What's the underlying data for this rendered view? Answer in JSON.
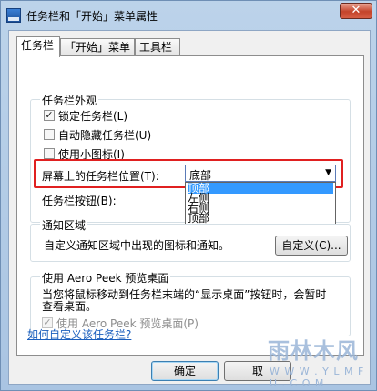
{
  "window": {
    "title": "任务栏和「开始」菜单属性",
    "close_glyph": "✕"
  },
  "tabs": [
    {
      "label": "任务栏"
    },
    {
      "label": "「开始」菜单"
    },
    {
      "label": "工具栏"
    }
  ],
  "appearance": {
    "group_title": "任务栏外观",
    "lock_taskbar": {
      "label": "锁定任务栏(L)",
      "checked": true
    },
    "auto_hide": {
      "label": "自动隐藏任务栏(U)",
      "checked": false
    },
    "small_icons": {
      "label": "使用小图标(I)",
      "checked": false
    },
    "location_label": "屏幕上的任务栏位置(T):",
    "location_value": "底部",
    "location_options": [
      "顶部",
      "左侧",
      "右侧",
      "顶部"
    ],
    "buttons_label": "任务栏按钮(B):"
  },
  "notification": {
    "group_title": "通知区域",
    "description": "自定义通知区域中出现的图标和通知。",
    "customize_button": "自定义(C)..."
  },
  "aero_peek": {
    "group_title": "使用 Aero Peek 预览桌面",
    "description_line1": "当您将鼠标移动到任务栏末端的“显示桌面”按钮时，会暂时",
    "description_line2": "查看桌面。",
    "use_peek": {
      "label": "使用 Aero Peek 预览桌面(P)",
      "checked": true
    }
  },
  "help_link": "如何自定义该任务栏?",
  "footer": {
    "ok": "确定",
    "cancel": "取"
  },
  "watermark": {
    "line1": "雨林木风",
    "line2": "W W W . Y L M F U . C O M"
  },
  "colors": {
    "highlight": "#e02020",
    "selection": "#3399ff",
    "link": "#1a5ebd"
  }
}
